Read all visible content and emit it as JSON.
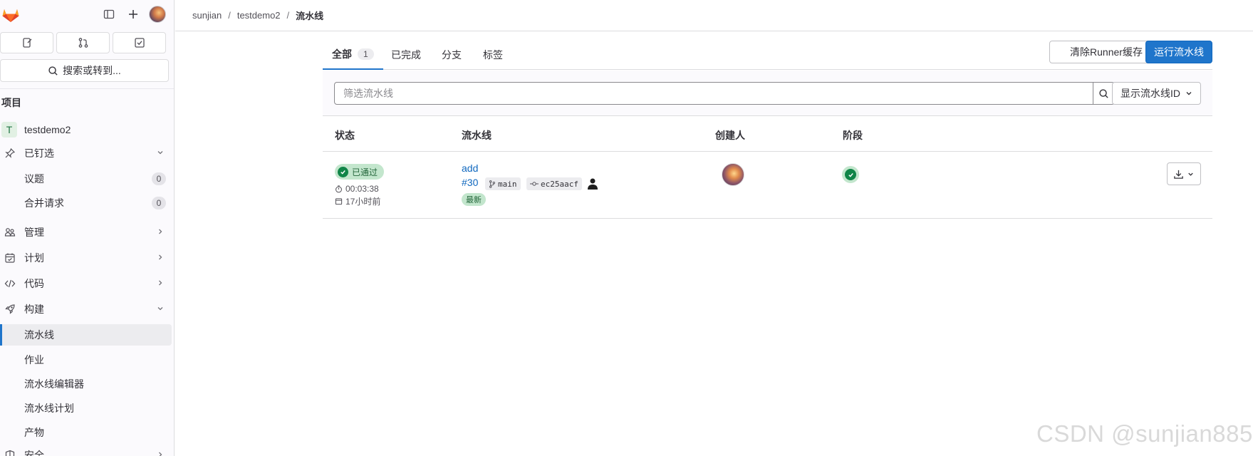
{
  "sidebar": {
    "search_label": "搜索或转到...",
    "section_title": "项目",
    "project_initial": "T",
    "project_name": "testdemo2",
    "pinned_label": "已钉选",
    "issues_label": "议题",
    "issues_count": "0",
    "mr_label": "合并请求",
    "mr_count": "0",
    "manage_label": "管理",
    "plan_label": "计划",
    "code_label": "代码",
    "build_label": "构建",
    "pipelines_label": "流水线",
    "jobs_label": "作业",
    "editor_label": "流水线编辑器",
    "schedules_label": "流水线计划",
    "artifacts_label": "产物",
    "security_label": "安全"
  },
  "breadcrumb": {
    "items": [
      "sunjian",
      "testdemo2",
      "流水线"
    ],
    "sep": "/"
  },
  "tabs": {
    "all_label": "全部",
    "all_count": "1",
    "finished_label": "已完成",
    "branches_label": "分支",
    "tags_label": "标签"
  },
  "actions": {
    "clear_cache_label": "清除Runner缓存",
    "run_pipeline_label": "运行流水线"
  },
  "filter": {
    "placeholder": "筛选流水线",
    "id_select_value": "显示流水线ID"
  },
  "table": {
    "headers": {
      "status": "状态",
      "pipeline": "流水线",
      "creator": "创建人",
      "stages": "阶段"
    },
    "rows": [
      {
        "status": "已通过",
        "duration": "00:03:38",
        "finished": "17小时前",
        "title": "add",
        "id": "#30",
        "branch": "main",
        "commit": "ec25aacf",
        "latest_badge": "最新"
      }
    ]
  },
  "watermark": "CSDN @sunjian885",
  "colors": {
    "accent": "#1f75cb",
    "success": "#108548",
    "success_bg": "#c3e6cd"
  }
}
